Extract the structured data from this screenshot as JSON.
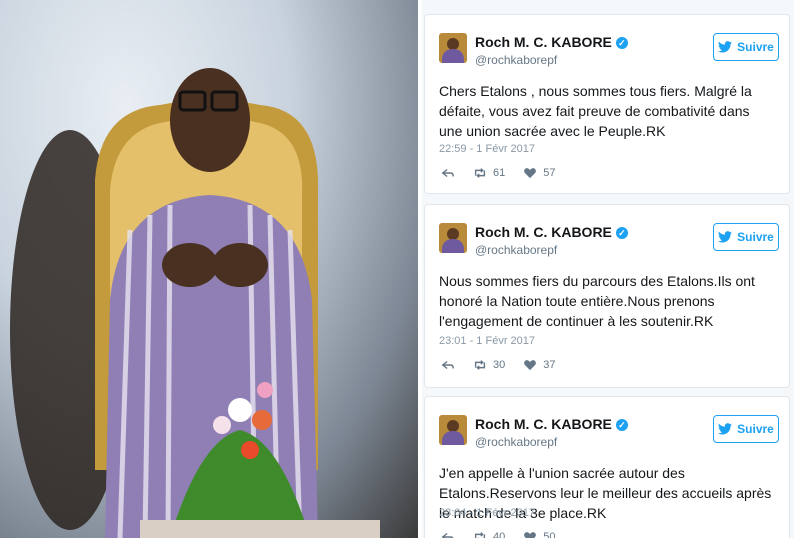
{
  "tweets": [
    {
      "author_name": "Roch M. C. KABORE",
      "handle": "@rochkaborepf",
      "follow_label": "Suivre",
      "text": "Chers Etalons , nous sommes tous fiers. Malgré la défaite, vous avez fait preuve de combativité dans une union sacrée avec le Peuple.RK",
      "timestamp": "22:59 - 1 Févr 2017",
      "retweets": "61",
      "likes": "57"
    },
    {
      "author_name": "Roch M. C. KABORE",
      "handle": "@rochkaborepf",
      "follow_label": "Suivre",
      "text": "Nous sommes fiers du parcours des Etalons.Ils ont honoré la Nation toute entière.Nous prenons l'engagement de continuer à les soutenir.RK",
      "timestamp": "23:01 - 1 Févr 2017",
      "retweets": "30",
      "likes": "37"
    },
    {
      "author_name": "Roch M. C. KABORE",
      "handle": "@rochkaborepf",
      "follow_label": "Suivre",
      "text": "J'en appelle à l'union sacrée autour des Etalons.Reservons leur le meilleur des accueils après le match de la 3e place.RK",
      "timestamp": "23:04 - 1 Févr 2017",
      "retweets": "40",
      "likes": "50"
    }
  ],
  "icons": [
    "verified-icon",
    "twitter-bird-icon",
    "reply-icon",
    "retweet-icon",
    "heart-icon"
  ],
  "colors": {
    "accent": "#1da1f2",
    "text": "#14171a",
    "muted": "#657786"
  }
}
